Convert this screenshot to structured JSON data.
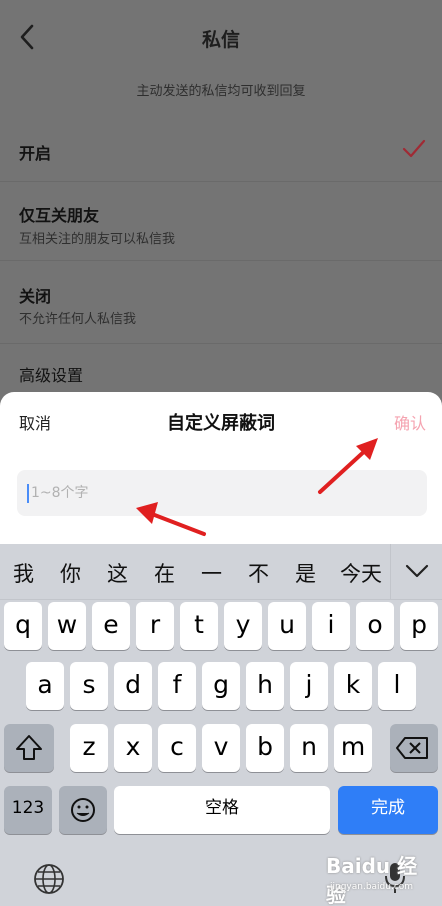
{
  "header": {
    "title": "私信"
  },
  "hint": "主动发送的私信均可收到回复",
  "options": [
    {
      "title": "开启",
      "subtitle": "",
      "selected": true
    },
    {
      "title": "仅互关朋友",
      "subtitle": "互相关注的朋友可以私信我",
      "selected": false
    },
    {
      "title": "关闭",
      "subtitle": "不允许任何人私信我",
      "selected": false
    },
    {
      "title": "高级设置",
      "subtitle": "",
      "selected": false
    }
  ],
  "sheet": {
    "cancel_label": "取消",
    "title": "自定义屏蔽词",
    "confirm_label": "确认",
    "input_value": "",
    "input_placeholder": "1~8个字"
  },
  "keyboard": {
    "candidates": [
      "我",
      "你",
      "这",
      "在",
      "一",
      "不",
      "是",
      "今天"
    ],
    "row1": [
      "q",
      "w",
      "e",
      "r",
      "t",
      "y",
      "u",
      "i",
      "o",
      "p"
    ],
    "row2": [
      "a",
      "s",
      "d",
      "f",
      "g",
      "h",
      "j",
      "k",
      "l"
    ],
    "row3": [
      "z",
      "x",
      "c",
      "v",
      "b",
      "n",
      "m"
    ],
    "numbers_label": "123",
    "space_label": "空格",
    "done_label": "完成"
  },
  "watermark": {
    "brand": "Baidu 经验",
    "sub": "jingyan.baidu.com"
  },
  "colors": {
    "accent": "#2f7ef7",
    "confirm_disabled": "#f5a3b0",
    "check": "#a02a34",
    "arrow": "#e02020"
  }
}
